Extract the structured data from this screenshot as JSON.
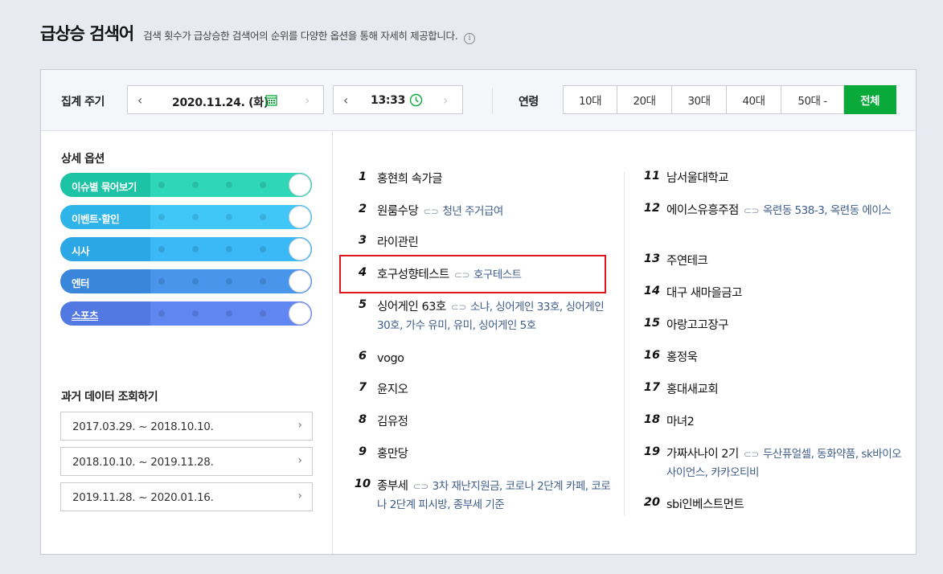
{
  "header": {
    "title": "급상승 검색어",
    "description": "검색 횟수가 급상승한 검색어의 순위를 다양한 옵션을 통해 자세히 제공합니다.",
    "info_glyph": "i"
  },
  "filter": {
    "period_label": "집계 주기",
    "date": "2020.11.24. (화)",
    "time": "13:33",
    "age_label": "연령",
    "ages": [
      {
        "label": "10대",
        "active": false
      },
      {
        "label": "20대",
        "active": false
      },
      {
        "label": "30대",
        "active": false
      },
      {
        "label": "40대",
        "active": false
      },
      {
        "label": "50대 -",
        "active": false
      },
      {
        "label": "전체",
        "active": true
      }
    ],
    "prev_glyph": "‹",
    "next_glyph": "›"
  },
  "options": {
    "title": "상세 옵션",
    "toggles": [
      {
        "label": "이슈별 묶어보기",
        "color": "#1cc4a5"
      },
      {
        "label": "이벤트·할인",
        "color": "#2eb4e8"
      },
      {
        "label": "시사",
        "color": "#2aa7e4"
      },
      {
        "label": "엔터",
        "color": "#3a86db"
      },
      {
        "label": "스포츠",
        "color": "#5278e2"
      }
    ]
  },
  "history": {
    "title": "과거 데이터 조회하기",
    "periods": [
      "2017.03.29. ~ 2018.10.10.",
      "2018.10.10. ~ 2019.11.28.",
      "2019.11.28. ~ 2020.01.16."
    ],
    "chevron_glyph": "›"
  },
  "ranking": {
    "left": [
      {
        "rank": "1",
        "keyword": "홍현희 속가글",
        "related": ""
      },
      {
        "rank": "2",
        "keyword": "원룸수당",
        "related": "청년 주거급여"
      },
      {
        "rank": "3",
        "keyword": "라이관린",
        "related": ""
      },
      {
        "rank": "4",
        "keyword": "호구성향테스트",
        "related": "호구테스트"
      },
      {
        "rank": "5",
        "keyword": "싱어게인 63호",
        "related": "소냐, 싱어게인 33호, 싱어게인 30호, 가수 유미, 유미, 싱어게인 5호"
      },
      {
        "rank": "6",
        "keyword": "vogo",
        "related": ""
      },
      {
        "rank": "7",
        "keyword": "윤지오",
        "related": ""
      },
      {
        "rank": "8",
        "keyword": "김유정",
        "related": ""
      },
      {
        "rank": "9",
        "keyword": "홍만당",
        "related": ""
      },
      {
        "rank": "10",
        "keyword": "종부세",
        "related": "3차 재난지원금, 코로나 2단계 카페, 코로나 2단계 피시방, 종부세 기준"
      }
    ],
    "right": [
      {
        "rank": "11",
        "keyword": "남서울대학교",
        "related": ""
      },
      {
        "rank": "12",
        "keyword": "에이스유흥주점",
        "related": "옥련동 538-3, 옥련동 에이스"
      },
      {
        "rank": "13",
        "keyword": "주연테크",
        "related": ""
      },
      {
        "rank": "14",
        "keyword": "대구 새마을금고",
        "related": ""
      },
      {
        "rank": "15",
        "keyword": "아랑고고장구",
        "related": ""
      },
      {
        "rank": "16",
        "keyword": "홍정욱",
        "related": ""
      },
      {
        "rank": "17",
        "keyword": "홍대새교회",
        "related": ""
      },
      {
        "rank": "18",
        "keyword": "마녀2",
        "related": ""
      },
      {
        "rank": "19",
        "keyword": "가짜사나이 2기",
        "related": "두산퓨얼셀, 동화약품, sk바이오사이언스, 카카오티비"
      },
      {
        "rank": "20",
        "keyword": "sbi인베스트먼트",
        "related": ""
      }
    ]
  },
  "colors": {
    "accent": "#09aa3a",
    "highlight": "#e0141b",
    "related_text": "#3f5d8a"
  }
}
